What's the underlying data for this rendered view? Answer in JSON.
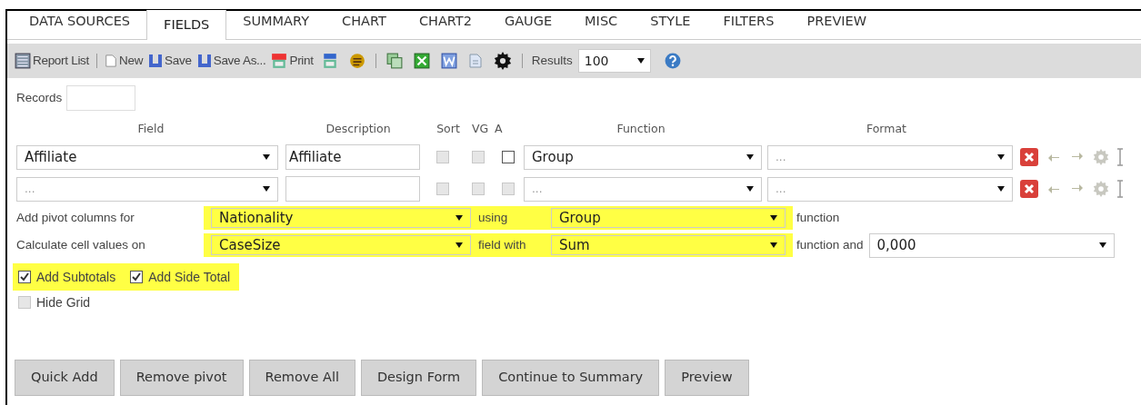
{
  "tabs": [
    {
      "label": "DATA SOURCES",
      "selected": false
    },
    {
      "label": "FIELDS",
      "selected": true
    },
    {
      "label": "SUMMARY",
      "selected": false
    },
    {
      "label": "CHART",
      "selected": false
    },
    {
      "label": "CHART2",
      "selected": false
    },
    {
      "label": "GAUGE",
      "selected": false
    },
    {
      "label": "MISC",
      "selected": false
    },
    {
      "label": "STYLE",
      "selected": false
    },
    {
      "label": "FILTERS",
      "selected": false
    },
    {
      "label": "PREVIEW",
      "selected": false
    }
  ],
  "toolbar": [
    {
      "kind": "button",
      "label": "Report List"
    },
    {
      "kind": "separator"
    },
    {
      "kind": "button",
      "label": "New"
    },
    {
      "kind": "button",
      "label": "Save"
    },
    {
      "kind": "button",
      "label": "Save As..."
    },
    {
      "kind": "button",
      "label": "Print"
    },
    {
      "kind": "icon"
    },
    {
      "kind": "icon"
    },
    {
      "kind": "separator"
    },
    {
      "kind": "icon"
    },
    {
      "kind": "icon"
    },
    {
      "kind": "icon"
    },
    {
      "kind": "icon"
    },
    {
      "kind": "icon"
    },
    {
      "kind": "separator"
    },
    {
      "kind": "label",
      "label": "Results"
    },
    {
      "kind": "select",
      "value": "100"
    },
    {
      "kind": "icon"
    }
  ],
  "records": {
    "label": "Records"
  },
  "columns": [
    "Field",
    "Description",
    "Sort",
    "VG",
    "A",
    "Function",
    "Format"
  ],
  "rows": [
    {
      "field": "Affiliate",
      "description": "Affiliate",
      "sort": {
        "checked": false,
        "disabled": true
      },
      "vg": {
        "checked": false,
        "disabled": true
      },
      "a": {
        "checked": false,
        "disabled": false
      },
      "function": "Group",
      "format": "..."
    },
    {
      "field": "...",
      "sort": {
        "checked": false,
        "disabled": true
      },
      "vg": {
        "checked": false,
        "disabled": true
      },
      "a": {
        "checked": false,
        "disabled": true
      },
      "function": "...",
      "format": "..."
    }
  ],
  "pivot": {
    "label": "Add pivot columns for",
    "value": "Nationality",
    "middle": "using",
    "function": "Group",
    "suffix": "function",
    "highlighted": true
  },
  "calculate": {
    "label": "Calculate cell values on",
    "value": "CaseSize",
    "middle": "field with",
    "function": "Sum",
    "suffix": "function and",
    "format": "0,000",
    "highlighted": true
  },
  "options": [
    {
      "label": "Add Subtotals",
      "checked": true,
      "highlighted": true
    },
    {
      "label": "Add Side Total",
      "checked": true,
      "highlighted": true
    },
    {
      "label": "Hide Grid",
      "checked": false,
      "highlighted": false
    }
  ],
  "buttons": [
    "Quick Add",
    "Remove pivot",
    "Remove All",
    "Design Form",
    "Continue to Summary",
    "Preview"
  ]
}
